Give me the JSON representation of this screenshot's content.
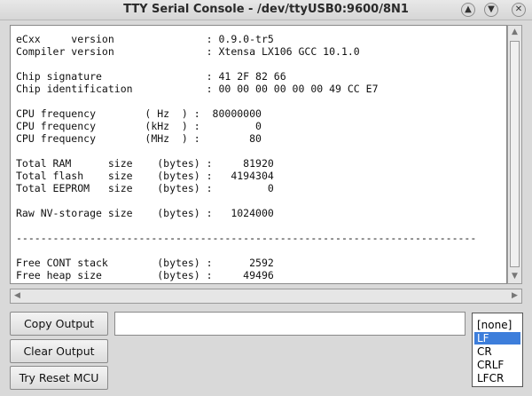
{
  "window": {
    "title": "TTY Serial Console - /dev/ttyUSB0:9600/8N1",
    "buttons": {
      "minimize_icon": "chevron-up-icon",
      "maximize_icon": "chevron-down-icon",
      "close_icon": "close-icon"
    }
  },
  "console": {
    "lines": [
      "eCxx     version               : 0.9.0-tr5",
      "Compiler version               : Xtensa LX106 GCC 10.1.0",
      "",
      "Chip signature                 : 41 2F 82 66",
      "Chip identification            : 00 00 00 00 00 00 49 CC E7",
      "",
      "CPU frequency        ( Hz  ) :  80000000",
      "CPU frequency        (kHz  ) :         0",
      "CPU frequency        (MHz  ) :        80",
      "",
      "Total RAM      size    (bytes) :     81920",
      "Total flash    size    (bytes) :   4194304",
      "Total EEPROM   size    (bytes) :         0",
      "",
      "Raw NV-storage size    (bytes) :   1024000",
      "",
      "---------------------------------------------------------------------------",
      "",
      "Free CONT stack        (bytes) :      2592",
      "Free heap size         (bytes) :     49496"
    ]
  },
  "actions": {
    "copy_output": "Copy Output",
    "clear_output": "Clear Output",
    "reset_mcu": "Try Reset MCU"
  },
  "send": {
    "input_value": ""
  },
  "eol": {
    "options": [
      "[none]",
      "LF",
      "CR",
      "CRLF",
      "LFCR"
    ],
    "selected": "LF",
    "selected_color": "#3d7edb"
  }
}
